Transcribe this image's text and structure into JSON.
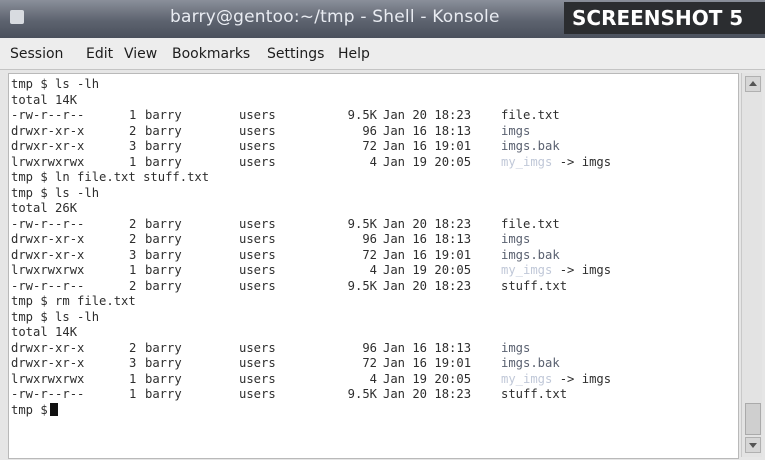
{
  "window": {
    "title": "barry@gentoo:~/tmp - Shell - Konsole",
    "badge": "SCREENSHOT 5"
  },
  "menu": [
    "Session",
    "Edit",
    "View",
    "Bookmarks",
    "Settings",
    "Help"
  ],
  "terminal": {
    "lines": [
      {
        "kind": "cmd",
        "text": "tmp $ ls -lh"
      },
      {
        "kind": "text",
        "text": "total 14K"
      },
      {
        "kind": "entry",
        "perm": "-rw-r--r--",
        "links": "1",
        "owner": "barry",
        "group": "users",
        "size": "9.5K",
        "date": "Jan 20 18:23",
        "name": "file.txt",
        "nameType": "file"
      },
      {
        "kind": "entry",
        "perm": "drwxr-xr-x",
        "links": "2",
        "owner": "barry",
        "group": "users",
        "size": "96",
        "date": "Jan 16 18:13",
        "name": "imgs",
        "nameType": "dir"
      },
      {
        "kind": "entry",
        "perm": "drwxr-xr-x",
        "links": "3",
        "owner": "barry",
        "group": "users",
        "size": "72",
        "date": "Jan 16 19:01",
        "name": "imgs.bak",
        "nameType": "dir"
      },
      {
        "kind": "entry",
        "perm": "lrwxrwxrwx",
        "links": "1",
        "owner": "barry",
        "group": "users",
        "size": "4",
        "date": "Jan 19 20:05",
        "name": "my_imgs",
        "nameType": "link",
        "target": "-> imgs"
      },
      {
        "kind": "cmd",
        "text": "tmp $ ln file.txt stuff.txt"
      },
      {
        "kind": "cmd",
        "text": "tmp $ ls -lh"
      },
      {
        "kind": "text",
        "text": "total 26K"
      },
      {
        "kind": "entry",
        "perm": "-rw-r--r--",
        "links": "2",
        "owner": "barry",
        "group": "users",
        "size": "9.5K",
        "date": "Jan 20 18:23",
        "name": "file.txt",
        "nameType": "file"
      },
      {
        "kind": "entry",
        "perm": "drwxr-xr-x",
        "links": "2",
        "owner": "barry",
        "group": "users",
        "size": "96",
        "date": "Jan 16 18:13",
        "name": "imgs",
        "nameType": "dir"
      },
      {
        "kind": "entry",
        "perm": "drwxr-xr-x",
        "links": "3",
        "owner": "barry",
        "group": "users",
        "size": "72",
        "date": "Jan 16 19:01",
        "name": "imgs.bak",
        "nameType": "dir"
      },
      {
        "kind": "entry",
        "perm": "lrwxrwxrwx",
        "links": "1",
        "owner": "barry",
        "group": "users",
        "size": "4",
        "date": "Jan 19 20:05",
        "name": "my_imgs",
        "nameType": "link",
        "target": "-> imgs"
      },
      {
        "kind": "entry",
        "perm": "-rw-r--r--",
        "links": "2",
        "owner": "barry",
        "group": "users",
        "size": "9.5K",
        "date": "Jan 20 18:23",
        "name": "stuff.txt",
        "nameType": "file"
      },
      {
        "kind": "cmd",
        "text": "tmp $ rm file.txt"
      },
      {
        "kind": "cmd",
        "text": "tmp $ ls -lh"
      },
      {
        "kind": "text",
        "text": "total 14K"
      },
      {
        "kind": "entry",
        "perm": "drwxr-xr-x",
        "links": "2",
        "owner": "barry",
        "group": "users",
        "size": "96",
        "date": "Jan 16 18:13",
        "name": "imgs",
        "nameType": "dir"
      },
      {
        "kind": "entry",
        "perm": "drwxr-xr-x",
        "links": "3",
        "owner": "barry",
        "group": "users",
        "size": "72",
        "date": "Jan 16 19:01",
        "name": "imgs.bak",
        "nameType": "dir"
      },
      {
        "kind": "entry",
        "perm": "lrwxrwxrwx",
        "links": "1",
        "owner": "barry",
        "group": "users",
        "size": "4",
        "date": "Jan 19 20:05",
        "name": "my_imgs",
        "nameType": "link",
        "target": "-> imgs"
      },
      {
        "kind": "entry",
        "perm": "-rw-r--r--",
        "links": "1",
        "owner": "barry",
        "group": "users",
        "size": "9.5K",
        "date": "Jan 20 18:23",
        "name": "stuff.txt",
        "nameType": "file"
      },
      {
        "kind": "prompt",
        "text": "tmp $"
      }
    ]
  }
}
